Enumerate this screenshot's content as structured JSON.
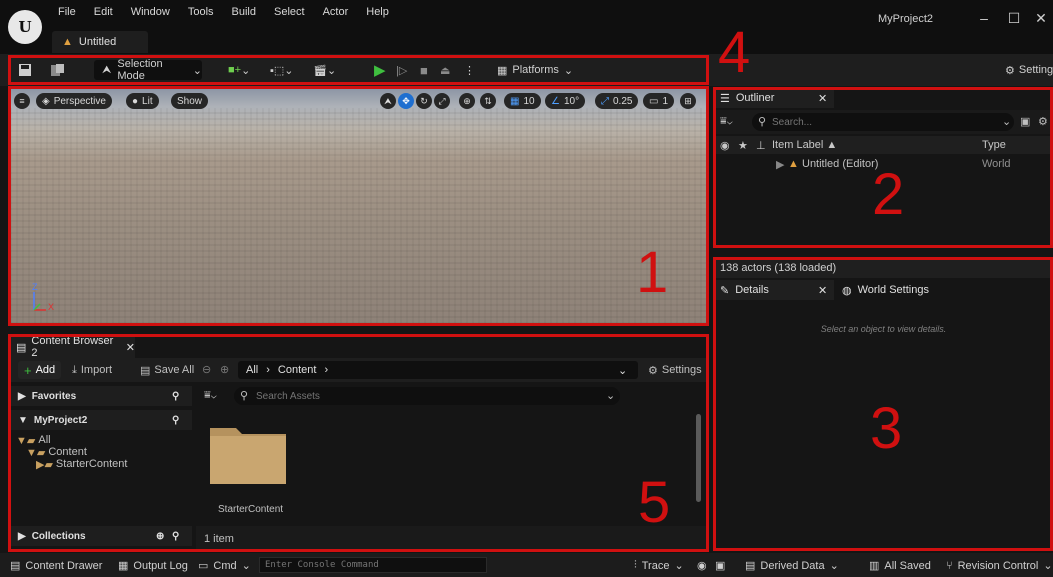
{
  "menu": [
    "File",
    "Edit",
    "Window",
    "Tools",
    "Build",
    "Select",
    "Actor",
    "Help"
  ],
  "document_tab": "Untitled",
  "project_name": "MyProject2",
  "toolbar": {
    "selection_mode": "Selection Mode",
    "platforms": "Platforms",
    "settings": "Settings"
  },
  "viewport": {
    "perspective": "Perspective",
    "lit": "Lit",
    "show": "Show",
    "grid_snap": "10",
    "rotation_snap": "10°",
    "scale_snap": "0.25",
    "camera_speed": "1",
    "axis_z": "Z",
    "axis_x": "X"
  },
  "outliner": {
    "tab": "Outliner",
    "search_placeholder": "Search...",
    "col_label": "Item Label ▲",
    "col_type": "Type",
    "row_label": "Untitled (Editor)",
    "row_type": "World"
  },
  "actors_count": "138 actors (138 loaded)",
  "details": {
    "tab_details": "Details",
    "tab_world": "World Settings",
    "empty_msg": "Select an object to view details."
  },
  "content_browser": {
    "tab": "Content Browser 2",
    "add": "Add",
    "import": "Import",
    "save_all": "Save All",
    "path_all": "All",
    "path_content": "Content",
    "settings": "Settings",
    "favorites": "Favorites",
    "project": "MyProject2",
    "tree_all": "All",
    "tree_content": "Content",
    "tree_starter": "StarterContent",
    "collections": "Collections",
    "search_placeholder": "Search Assets",
    "asset_name": "StarterContent",
    "item_count": "1 item"
  },
  "statusbar": {
    "content_drawer": "Content Drawer",
    "output_log": "Output Log",
    "cmd": "Cmd",
    "console_placeholder": "Enter Console Command",
    "trace": "Trace",
    "derived_data": "Derived Data",
    "all_saved": "All Saved",
    "revision_control": "Revision Control"
  },
  "callouts": [
    "1",
    "2",
    "3",
    "4",
    "5"
  ],
  "colors": {
    "callout_red": "#d01010",
    "accent_blue": "#1f6fd0",
    "play_green": "#3fbf3f",
    "folder": "#b5925e"
  }
}
